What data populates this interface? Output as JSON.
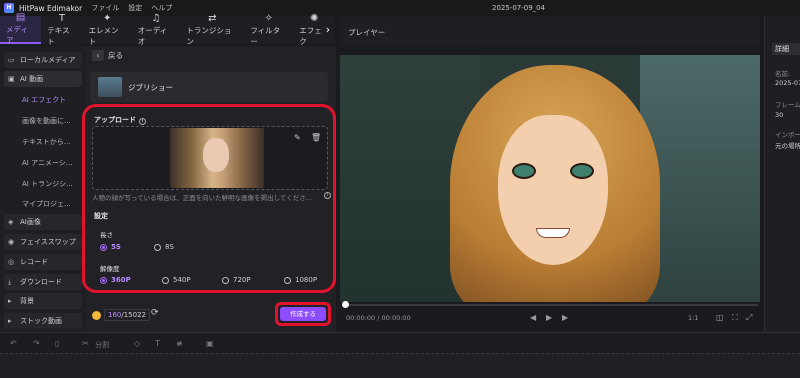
{
  "titlebar": {
    "app_name": "HitPaw Edimakor",
    "menu": [
      "ファイル",
      "設定",
      "ヘルプ"
    ],
    "project_title": "2025-07-09_04"
  },
  "toolbar": {
    "tabs": [
      {
        "label": "メディア",
        "icon": "folder-icon",
        "glyph": "▤"
      },
      {
        "label": "テキスト",
        "icon": "text-icon",
        "glyph": "T"
      },
      {
        "label": "エレメント",
        "icon": "element-icon",
        "glyph": "✦"
      },
      {
        "label": "オーディオ",
        "icon": "audio-icon",
        "glyph": "♫"
      },
      {
        "label": "トランジション",
        "icon": "transition-icon",
        "glyph": "⇄"
      },
      {
        "label": "フィルター",
        "icon": "filter-icon",
        "glyph": "✧"
      },
      {
        "label": "エフェク",
        "icon": "effect-icon",
        "glyph": "✺"
      }
    ],
    "more_arrow": "›"
  },
  "sidebar": {
    "groups": [
      {
        "label": "ローカルメディア",
        "glyph": "▭"
      },
      {
        "label": "AI 動画",
        "glyph": "▣"
      },
      {
        "label": "AI画像",
        "glyph": "◈"
      },
      {
        "label": "フェイススワップ",
        "glyph": "◉"
      },
      {
        "label": "レコード",
        "glyph": "◎"
      },
      {
        "label": "ダウンロード",
        "glyph": "⤓"
      },
      {
        "label": "背景",
        "glyph": "▸"
      },
      {
        "label": "ストック動画",
        "glyph": "▸"
      }
    ],
    "ai_video_items": [
      "AI エフェクト",
      "画像を動画に...",
      "テキストから...",
      "AI アニメーシ...",
      "AI トランジシ...",
      "マイプロジェ..."
    ]
  },
  "panel": {
    "back_label": "戻る",
    "style_name": "ジブリショー",
    "upload_label": "アップロード",
    "hint": "人物の顔が写っている場合は、正面を向いた鮮明な画像を掲出してくださ...",
    "settings_label": "設定",
    "length_label": "長さ",
    "length_options": [
      "5S",
      "8S"
    ],
    "length_selected": "5S",
    "resolution_label": "解像度",
    "resolution_options": [
      "360P",
      "540P",
      "720P",
      "1080P"
    ],
    "resolution_selected": "360P",
    "credits_used": "160",
    "credits_total": "/15022",
    "create_label": "作成する"
  },
  "player": {
    "title": "プレイヤー",
    "time": "00:00:00 / 00:00:00",
    "ratio": "1:1"
  },
  "details": {
    "tab": "詳細",
    "name_label": "名前:",
    "name_value": "2025-07",
    "frame_label": "フレーム",
    "frame_value": "30",
    "import_label": "インポー",
    "import_value": "元の場所"
  },
  "timeline": {
    "split_label": "分割"
  },
  "colors": {
    "accent": "#8d4dff",
    "highlight_outline": "#e3122d",
    "coin": "#f1b83d"
  }
}
